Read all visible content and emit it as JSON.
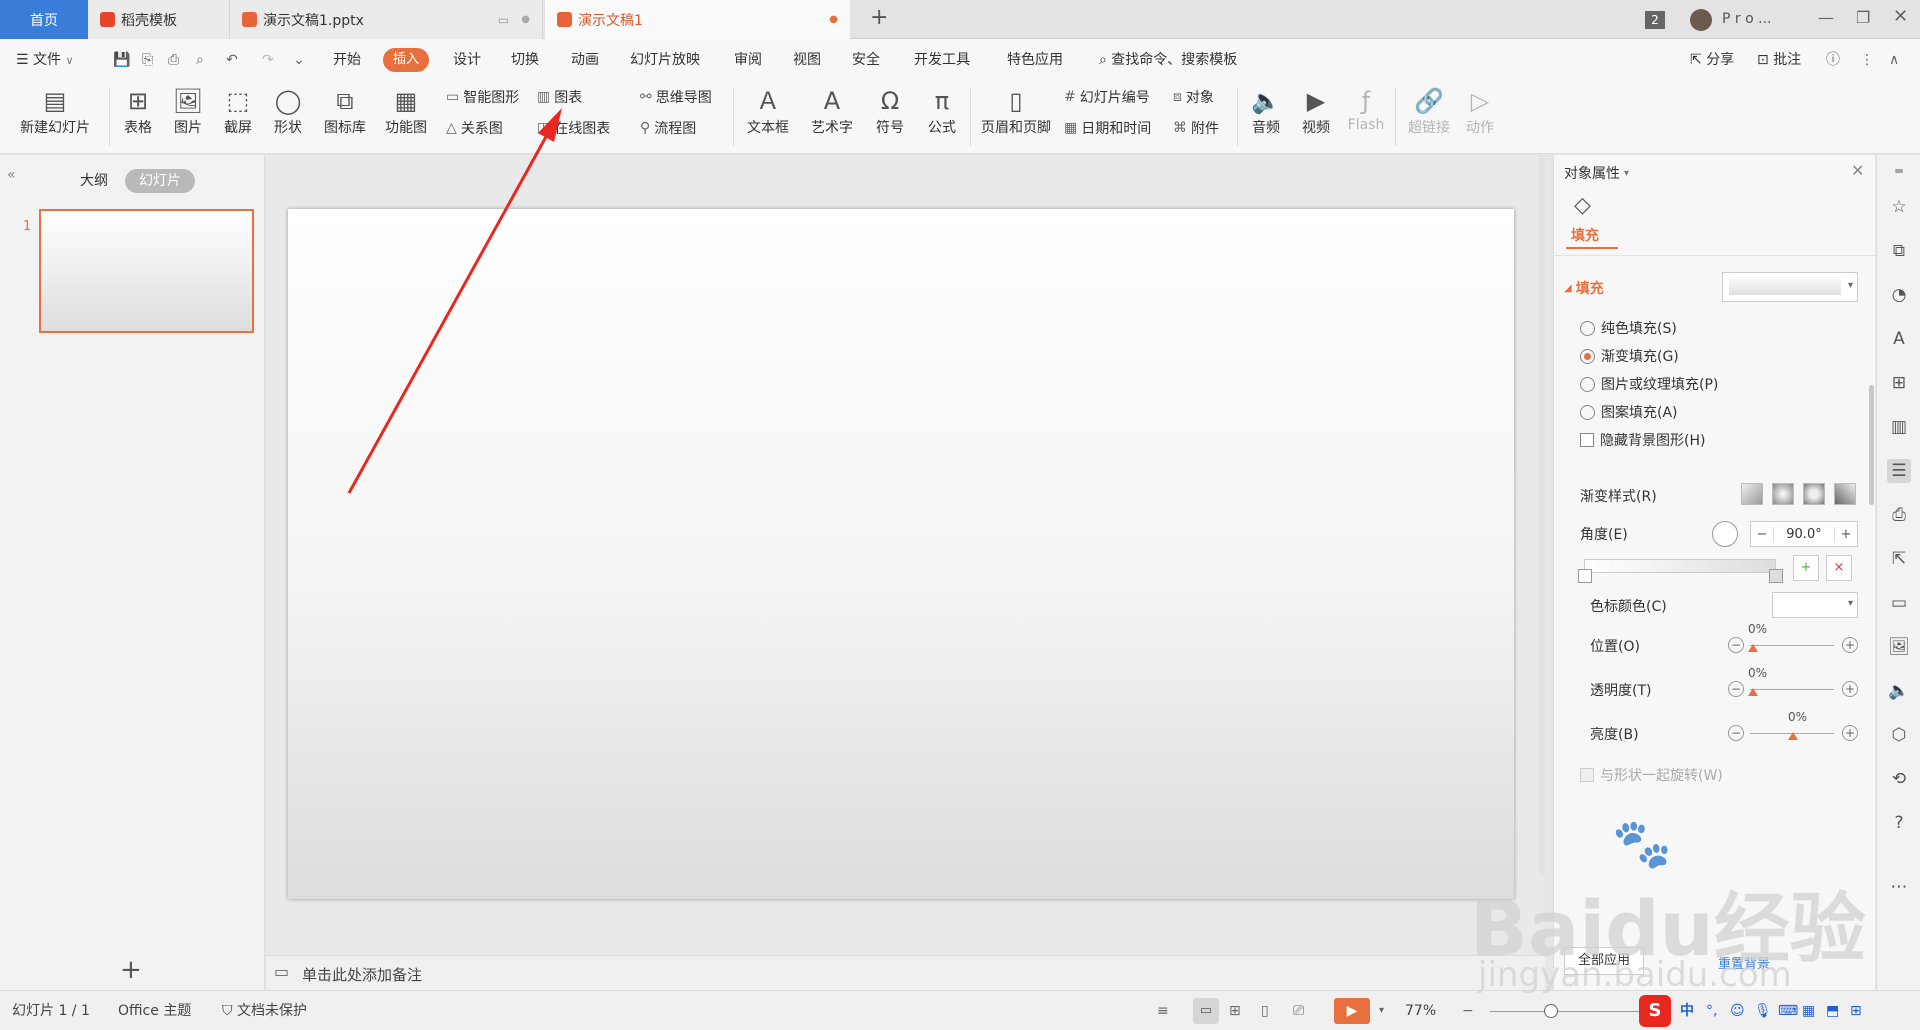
{
  "tabs": {
    "home": "首页",
    "template": "稻壳模板",
    "doc1": "演示文稿1.pptx",
    "doc2": "演示文稿1",
    "new": "+",
    "badge": "2",
    "user": "P r o ..."
  },
  "menu": {
    "file": "文件",
    "items": [
      "开始",
      "插入",
      "设计",
      "切换",
      "动画",
      "幻灯片放映",
      "审阅",
      "视图",
      "安全",
      "开发工具",
      "特色应用"
    ],
    "search": "查找命令、搜索模板",
    "share": "分享",
    "comment": "批注"
  },
  "ribbon": {
    "new_slide": "新建幻灯片",
    "table": "表格",
    "picture": "图片",
    "screenshot": "截屏",
    "shape": "形状",
    "icon_lib": "图标库",
    "func_chart": "功能图",
    "smart_art": "智能图形",
    "chart": "图表",
    "relation": "关系图",
    "online_chart": "在线图表",
    "mind_map": "思维导图",
    "flow_chart": "流程图",
    "textbox": "文本框",
    "art_text": "艺术字",
    "symbol": "符号",
    "formula": "公式",
    "header_footer": "页眉和页脚",
    "slide_number": "幻灯片编号",
    "object": "对象",
    "date_time": "日期和时间",
    "attachment": "附件",
    "audio": "音频",
    "video": "视频",
    "flash": "Flash",
    "hyperlink": "超链接",
    "action": "动作"
  },
  "left_pane": {
    "outline": "大纲",
    "slides": "幻灯片",
    "slide_index": "1",
    "add": "+"
  },
  "notes": {
    "placeholder": "单击此处添加备注"
  },
  "props": {
    "title": "对象属性",
    "tab_fill": "填充",
    "section": "填充",
    "solid": "纯色填充(S)",
    "gradient": "渐变填充(G)",
    "picture_texture": "图片或纹理填充(P)",
    "pattern": "图案填充(A)",
    "hide_bg": "隐藏背景图形(H)",
    "gradient_style": "渐变样式(R)",
    "angle_label": "角度(E)",
    "angle_value": "90.0°",
    "stop_color": "色标颜色(C)",
    "position_label": "位置(O)",
    "position_value": "0%",
    "transparency_label": "透明度(T)",
    "transparency_value": "0%",
    "brightness_label": "亮度(B)",
    "brightness_value": "0%",
    "rotate_with_shape": "与形状一起旋转(W)",
    "apply_all": "全部应用",
    "reset": "重置背景"
  },
  "status": {
    "slide_pos": "幻灯片 1 / 1",
    "theme": "Office 主题",
    "protect": "文档未保护",
    "zoom": "77%"
  },
  "watermark": {
    "brand": "Baidu经验",
    "url": "jingyan.baidu.com"
  },
  "colors": {
    "accent": "#e8703f",
    "home_tab": "#3a7dd8",
    "arrow": "#e8281e"
  }
}
